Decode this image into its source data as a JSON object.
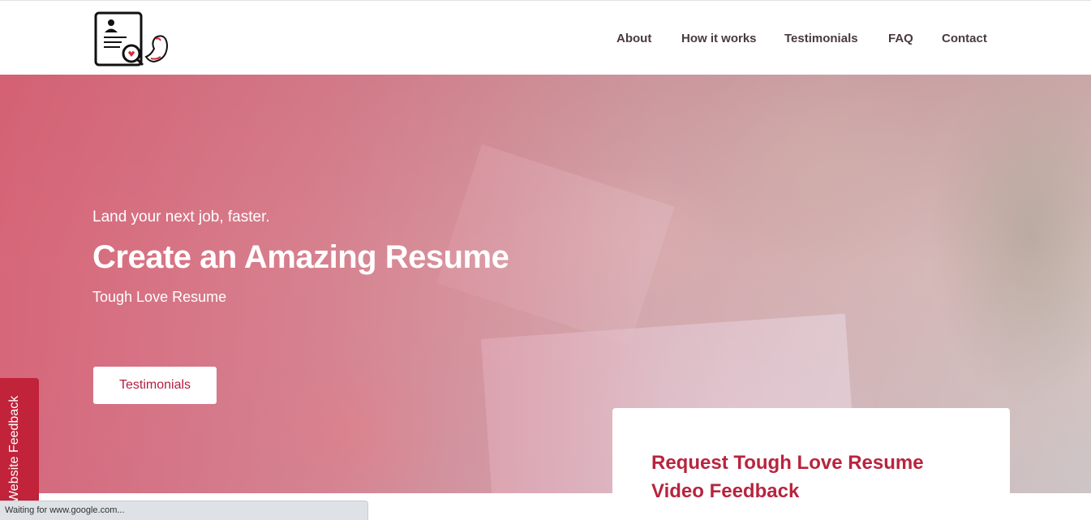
{
  "nav": {
    "items": [
      {
        "label": "About"
      },
      {
        "label": "How it works"
      },
      {
        "label": "Testimonials"
      },
      {
        "label": "FAQ"
      },
      {
        "label": "Contact"
      }
    ]
  },
  "logo": {
    "icon": "resume-magnifier-bicep-logo"
  },
  "hero": {
    "subtitle": "Land your next job, faster.",
    "title": "Create an Amazing Resume",
    "brand": "Tough Love Resume",
    "button_label": "Testimonials"
  },
  "card": {
    "title": "Request Tough Love Resume Video Feedback"
  },
  "feedback_tab": {
    "label": "Website Feedback"
  },
  "status_bar": {
    "text": "Waiting for www.google.com..."
  },
  "colors": {
    "accent": "#b8243e",
    "nav_text": "#4a3a3f",
    "overlay": "#d64f68",
    "feedback_tab": "#c0233a"
  }
}
